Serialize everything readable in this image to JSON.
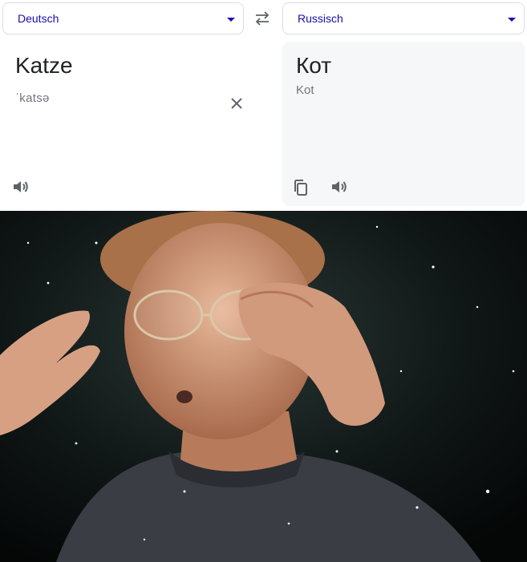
{
  "source_language": {
    "label": "Deutsch"
  },
  "target_language": {
    "label": "Russisch"
  },
  "source": {
    "text": "Katze",
    "phonetic": "ˈkatsə"
  },
  "target": {
    "text": "Кот",
    "transliteration": "Kot"
  },
  "icons": {
    "swap": "swap-languages-icon",
    "clear": "close-icon",
    "listen_source": "speaker-icon",
    "copy": "copy-icon",
    "listen_target": "speaker-icon"
  },
  "colors": {
    "language_label": "#1a0dab",
    "target_panel_bg": "#f6f7f9",
    "muted_text": "#70757a"
  },
  "image": {
    "subject": "man-with-glasses-mind-blown-meme"
  }
}
